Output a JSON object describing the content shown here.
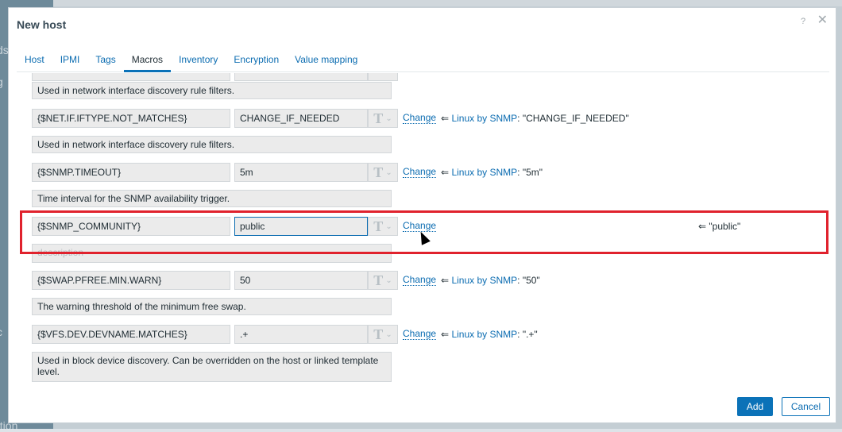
{
  "background": {
    "sidebar_fragments": [
      "ds",
      "g",
      "c",
      "ation"
    ]
  },
  "dialog": {
    "title": "New host",
    "help_icon": "?",
    "close_icon": "✕"
  },
  "tabs": [
    {
      "label": "Host"
    },
    {
      "label": "IPMI"
    },
    {
      "label": "Tags"
    },
    {
      "label": "Macros",
      "active": true
    },
    {
      "label": "Inventory"
    },
    {
      "label": "Encryption"
    },
    {
      "label": "Value mapping"
    }
  ],
  "macros": [
    {
      "desc": "Used in network interface discovery rule filters."
    },
    {
      "macro": "{$NET.IF.IFTYPE.NOT_MATCHES}",
      "value": "CHANGE_IF_NEEDED",
      "change": "Change",
      "arrow": "⇐",
      "template": "Linux by SNMP",
      "inherited": ": \"CHANGE_IF_NEEDED\"",
      "desc": "Used in network interface discovery rule filters."
    },
    {
      "macro": "{$SNMP.TIMEOUT}",
      "value": "5m",
      "change": "Change",
      "arrow": "⇐",
      "template": "Linux by SNMP",
      "inherited": ": \"5m\"",
      "desc": "Time interval for the SNMP availability trigger."
    },
    {
      "macro": "{$SNMP_COMMUNITY}",
      "value": "public",
      "change": "Change",
      "arrow": "⇐",
      "inherited": "\"public\"",
      "desc_placeholder": "description"
    },
    {
      "macro": "{$SWAP.PFREE.MIN.WARN}",
      "value": "50",
      "change": "Change",
      "arrow": "⇐",
      "template": "Linux by SNMP",
      "inherited": ": \"50\"",
      "desc": "The warning threshold of the minimum free swap."
    },
    {
      "macro": "{$VFS.DEV.DEVNAME.MATCHES}",
      "value": ".+",
      "change": "Change",
      "arrow": "⇐",
      "template": "Linux by SNMP",
      "inherited": ": \".+\"",
      "desc": "Used in block device discovery. Can be overridden on the host or linked template level."
    }
  ],
  "type_icon": "T",
  "footer": {
    "add": "Add",
    "cancel": "Cancel"
  },
  "colors": {
    "accent": "#0b72b8",
    "highlight": "#e0222d"
  }
}
